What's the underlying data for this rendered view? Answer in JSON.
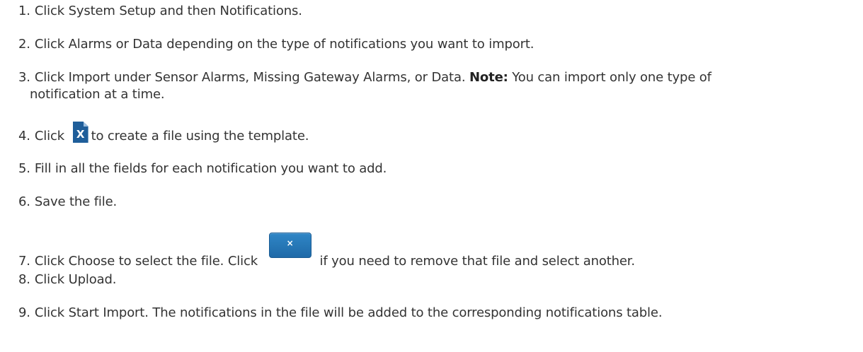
{
  "steps": [
    {
      "num": "1.",
      "text": "Click System Setup and then Notifications."
    },
    {
      "num": "2.",
      "text": "Click Alarms or Data depending on the type of notifications you want to import."
    },
    {
      "num": "3.",
      "text": "Click Import under Sensor Alarms, Missing Gateway Alarms, or Data.",
      "note_label": "Note:",
      "note_text": " You can import only one type of",
      "continuation": "notification at a time."
    },
    {
      "num": "4.",
      "before": "Click ",
      "icon": "excel-file-icon",
      "icon_glyph": "X",
      "after": "to create a file using the template."
    },
    {
      "num": "5.",
      "text": "Fill in all the fields for each notification you want to add."
    },
    {
      "num": "6.",
      "text": "Save the file."
    },
    {
      "num": "7.",
      "before": "Click Choose to select the file. Click ",
      "button_icon": "close-icon",
      "button_glyph": "×",
      "after": "if you need to remove that file and select another."
    },
    {
      "num": "8.",
      "text": "Click Upload."
    },
    {
      "num": "9.",
      "text": "Click Start Import. The notifications in the file will be added to the corresponding notifications table."
    }
  ],
  "colors": {
    "text": "#333333",
    "icon_blue": "#1f5e9a",
    "button_blue": "#2f86c6"
  }
}
